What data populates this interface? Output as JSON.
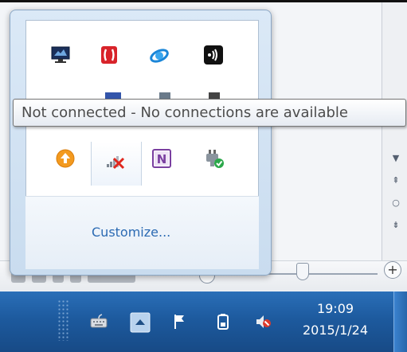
{
  "tooltip": {
    "text": "Not connected - No connections are available"
  },
  "flyout": {
    "customize_label": "Customize...",
    "icons_row1": [
      "monitor-app-icon",
      "red-app-icon",
      "ie-app-icon",
      "wireless-app-icon"
    ],
    "icons_row3": [
      "update-icon",
      "network-disconnected-icon",
      "onenote-icon",
      "power-check-icon"
    ]
  },
  "taskbar": {
    "time": "19:09",
    "date": "2015/1/24",
    "tray_icons": [
      "keyboard-icon",
      "show-hidden-icons-arrow",
      "action-center-flag-icon",
      "battery-icon",
      "volume-muted-icon"
    ]
  },
  "zoom": {
    "plus_label": "+"
  },
  "colors": {
    "taskbar": "#1d5a9e",
    "link": "#2b6ab3",
    "flyout_border": "#8ba7c5"
  }
}
